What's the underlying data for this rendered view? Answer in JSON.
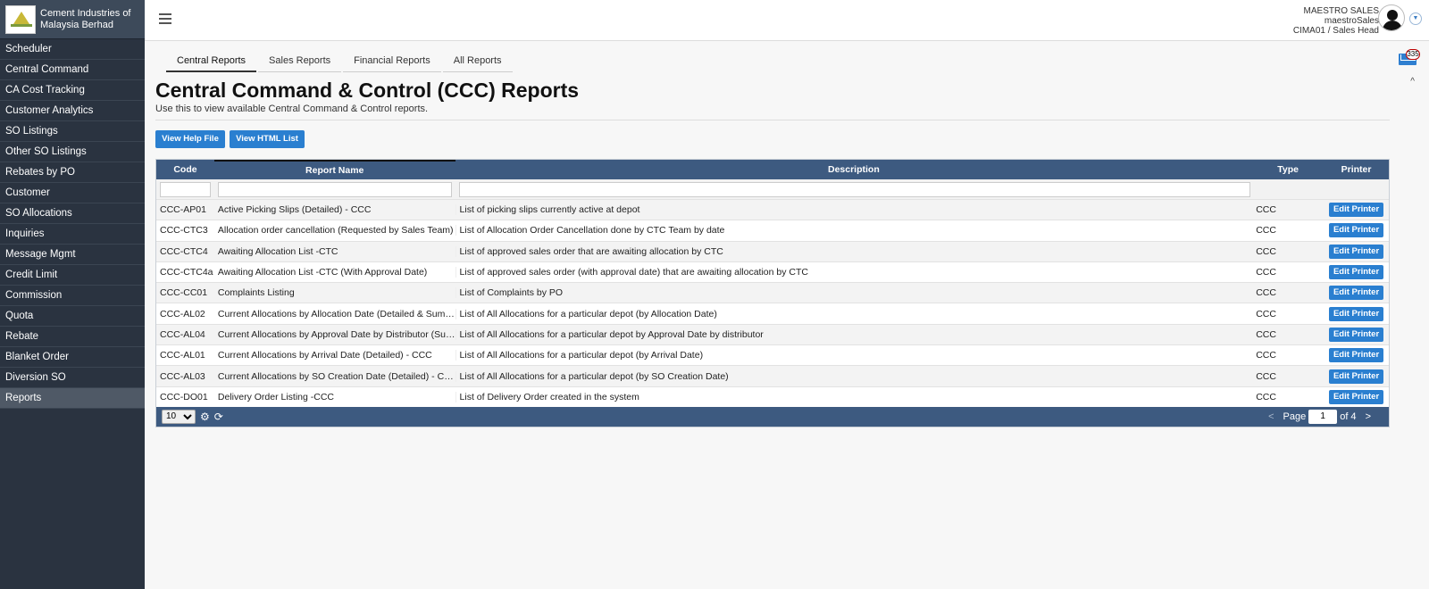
{
  "brand": {
    "name": "Cement Industries of Malaysia Berhad"
  },
  "sidebar": {
    "items": [
      {
        "label": "Scheduler"
      },
      {
        "label": "Central Command"
      },
      {
        "label": "CA Cost Tracking"
      },
      {
        "label": "Customer Analytics"
      },
      {
        "label": "SO Listings"
      },
      {
        "label": "Other SO Listings"
      },
      {
        "label": "Rebates by PO"
      },
      {
        "label": "Customer"
      },
      {
        "label": "SO Allocations"
      },
      {
        "label": "Inquiries"
      },
      {
        "label": "Message Mgmt"
      },
      {
        "label": "Credit Limit"
      },
      {
        "label": "Commission"
      },
      {
        "label": "Quota"
      },
      {
        "label": "Rebate"
      },
      {
        "label": "Blanket Order"
      },
      {
        "label": "Diversion SO"
      },
      {
        "label": "Reports"
      }
    ],
    "active_index": 17
  },
  "header": {
    "user_name": "MAESTRO SALES",
    "user_login": "maestroSales",
    "user_role": "CIMA01 / Sales Head"
  },
  "tabs": [
    {
      "label": "Central Reports"
    },
    {
      "label": "Sales Reports"
    },
    {
      "label": "Financial Reports"
    },
    {
      "label": "All Reports"
    }
  ],
  "mail": {
    "count": "335"
  },
  "page": {
    "title": "Central Command & Control (CCC) Reports",
    "subtitle": "Use this to view available Central Command & Control reports.",
    "help_button": "View Help File",
    "html_button": "View HTML List"
  },
  "table": {
    "columns": {
      "code": "Code",
      "name": "Report Name",
      "desc": "Description",
      "type": "Type",
      "printer": "Printer"
    },
    "edit_label": "Edit Printer",
    "rows": [
      {
        "code": "CCC-AP01",
        "name": "Active Picking Slips (Detailed) - CCC",
        "desc": "List of picking slips currently active at depot",
        "type": "CCC"
      },
      {
        "code": "CCC-CTC3",
        "name": "Allocation order cancellation (Requested by Sales Team)",
        "desc": "List of Allocation Order Cancellation done by CTC Team by date",
        "type": "CCC"
      },
      {
        "code": "CCC-CTC4",
        "name": "Awaiting Allocation List -CTC",
        "desc": "List of approved sales order that are awaiting allocation by CTC",
        "type": "CCC"
      },
      {
        "code": "CCC-CTC4a",
        "name": "Awaiting Allocation List -CTC (With Approval Date)",
        "desc": "List of approved sales order (with approval date) that are awaiting allocation by CTC",
        "type": "CCC"
      },
      {
        "code": "CCC-CC01",
        "name": "Complaints Listing",
        "desc": "List of Complaints by PO",
        "type": "CCC"
      },
      {
        "code": "CCC-AL02",
        "name": "Current Allocations by Allocation Date (Detailed & Summary)",
        "desc": "List of All Allocations for a particular depot (by Allocation Date)",
        "type": "CCC"
      },
      {
        "code": "CCC-AL04",
        "name": "Current Allocations by Approval Date by Distributor (Summary)",
        "desc": "List of All Allocations for a particular depot by Approval Date by distributor",
        "type": "CCC"
      },
      {
        "code": "CCC-AL01",
        "name": "Current Allocations by Arrival Date (Detailed) - CCC",
        "desc": "List of All Allocations for a particular depot (by Arrival Date)",
        "type": "CCC"
      },
      {
        "code": "CCC-AL03",
        "name": "Current Allocations by SO Creation Date (Detailed) - CCC",
        "desc": "List of All Allocations for a particular depot (by SO Creation Date)",
        "type": "CCC"
      },
      {
        "code": "CCC-DO01",
        "name": "Delivery Order Listing -CCC",
        "desc": "List of Delivery Order created in the system",
        "type": "CCC"
      }
    ]
  },
  "pager": {
    "page_size": "10",
    "prev": "<",
    "page_label": "Page",
    "current_page": "1",
    "of_label": "of 4",
    "next": ">"
  }
}
